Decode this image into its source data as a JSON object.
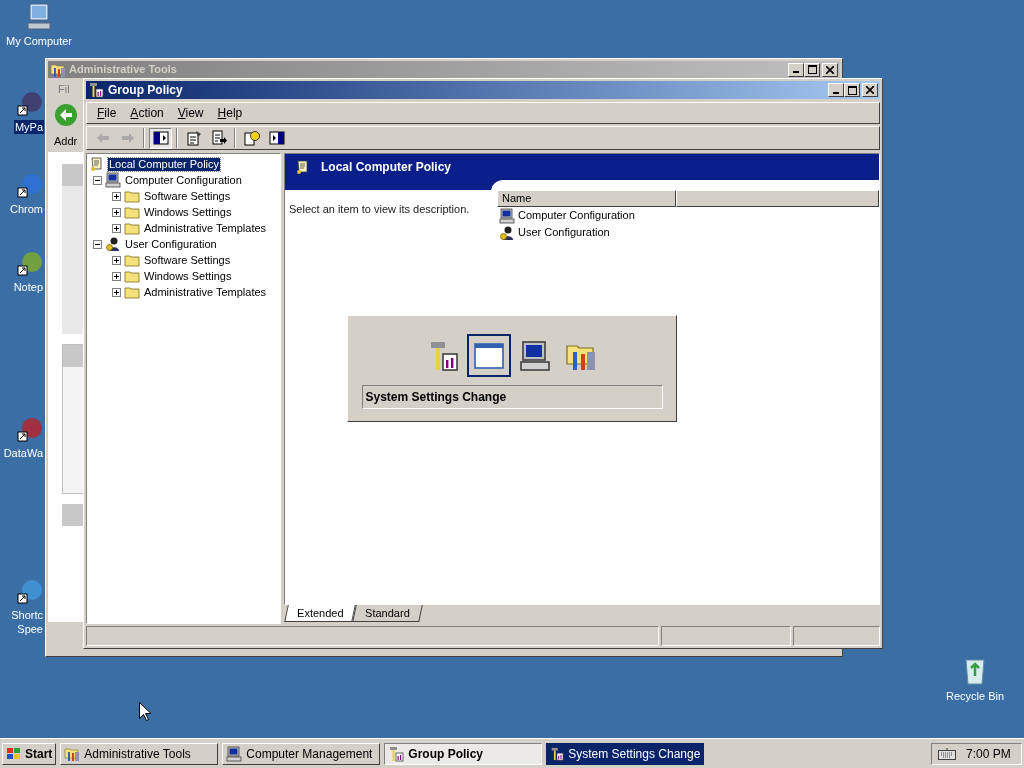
{
  "desktop_icons": [
    {
      "label": "My Computer",
      "kind": "computer",
      "selected": false
    },
    {
      "label": "MyPa",
      "kind": "app",
      "selected": true
    },
    {
      "label": "Chrom",
      "kind": "browser",
      "selected": false
    },
    {
      "label": "Notep",
      "kind": "notepad",
      "selected": false
    },
    {
      "label": "DataWa",
      "kind": "data",
      "selected": false
    },
    {
      "label": "Shortc Spee",
      "kind": "people",
      "selected": false
    }
  ],
  "recycle_bin": {
    "label": "Recycle Bin"
  },
  "background_window": {
    "title": "Administrative Tools",
    "menu": "Fil",
    "address_label": "Addr"
  },
  "window": {
    "title": "Group Policy",
    "menu": [
      "File",
      "Action",
      "View",
      "Help"
    ],
    "toolbar": [
      {
        "kind": "back",
        "disabled": true,
        "pressed": false
      },
      {
        "kind": "forward",
        "disabled": true,
        "pressed": false
      },
      {
        "kind": "separator"
      },
      {
        "kind": "tree",
        "disabled": false,
        "pressed": true
      },
      {
        "kind": "separator"
      },
      {
        "kind": "properties",
        "disabled": false,
        "pressed": false
      },
      {
        "kind": "export",
        "disabled": false,
        "pressed": false
      },
      {
        "kind": "separator"
      },
      {
        "kind": "help",
        "disabled": false,
        "pressed": false
      },
      {
        "kind": "pane",
        "disabled": false,
        "pressed": false
      }
    ],
    "tree": {
      "label": "Local Computer Policy",
      "kind": "policy",
      "selected": true,
      "children": [
        {
          "label": "Computer Configuration",
          "kind": "computer",
          "selected": false,
          "expanded": true,
          "children": [
            {
              "label": "Software Settings",
              "kind": "folder",
              "selected": false,
              "expanded": false
            },
            {
              "label": "Windows Settings",
              "kind": "folder",
              "selected": false,
              "expanded": false
            },
            {
              "label": "Administrative Templates",
              "kind": "folder",
              "selected": false,
              "expanded": false
            }
          ]
        },
        {
          "label": "User Configuration",
          "kind": "user",
          "selected": false,
          "expanded": true,
          "children": [
            {
              "label": "Software Settings",
              "kind": "folder",
              "selected": false,
              "expanded": false
            },
            {
              "label": "Windows Settings",
              "kind": "folder",
              "selected": false,
              "expanded": false
            },
            {
              "label": "Administrative Templates",
              "kind": "folder",
              "selected": false,
              "expanded": false
            }
          ]
        }
      ]
    },
    "detail": {
      "header": "Local Computer Policy",
      "description": "Select an item to view its description.",
      "columns": [
        "Name"
      ],
      "items": [
        {
          "label": "Computer Configuration",
          "kind": "computer"
        },
        {
          "label": "User Configuration",
          "kind": "user"
        }
      ]
    },
    "view_tabs": [
      {
        "label": "Extended",
        "selected": true
      },
      {
        "label": "Standard",
        "selected": false
      }
    ]
  },
  "task_switcher": {
    "items": [
      {
        "kind": "tools",
        "selected": false
      },
      {
        "kind": "window",
        "selected": true
      },
      {
        "kind": "computer",
        "selected": false
      },
      {
        "kind": "folder-tools",
        "selected": false
      }
    ],
    "caption": "System Settings Change"
  },
  "taskbar": {
    "start": "Start",
    "buttons": [
      {
        "label": "Administrative Tools",
        "kind": "folder-tools",
        "active": false,
        "highlighted": false
      },
      {
        "label": "Computer Management",
        "kind": "computer",
        "active": false,
        "highlighted": false
      },
      {
        "label": "Group Policy",
        "kind": "tools",
        "active": true,
        "highlighted": false
      },
      {
        "label": "System Settings Change",
        "kind": "tools",
        "active": false,
        "highlighted": true
      }
    ],
    "clock": "7:00 PM"
  }
}
